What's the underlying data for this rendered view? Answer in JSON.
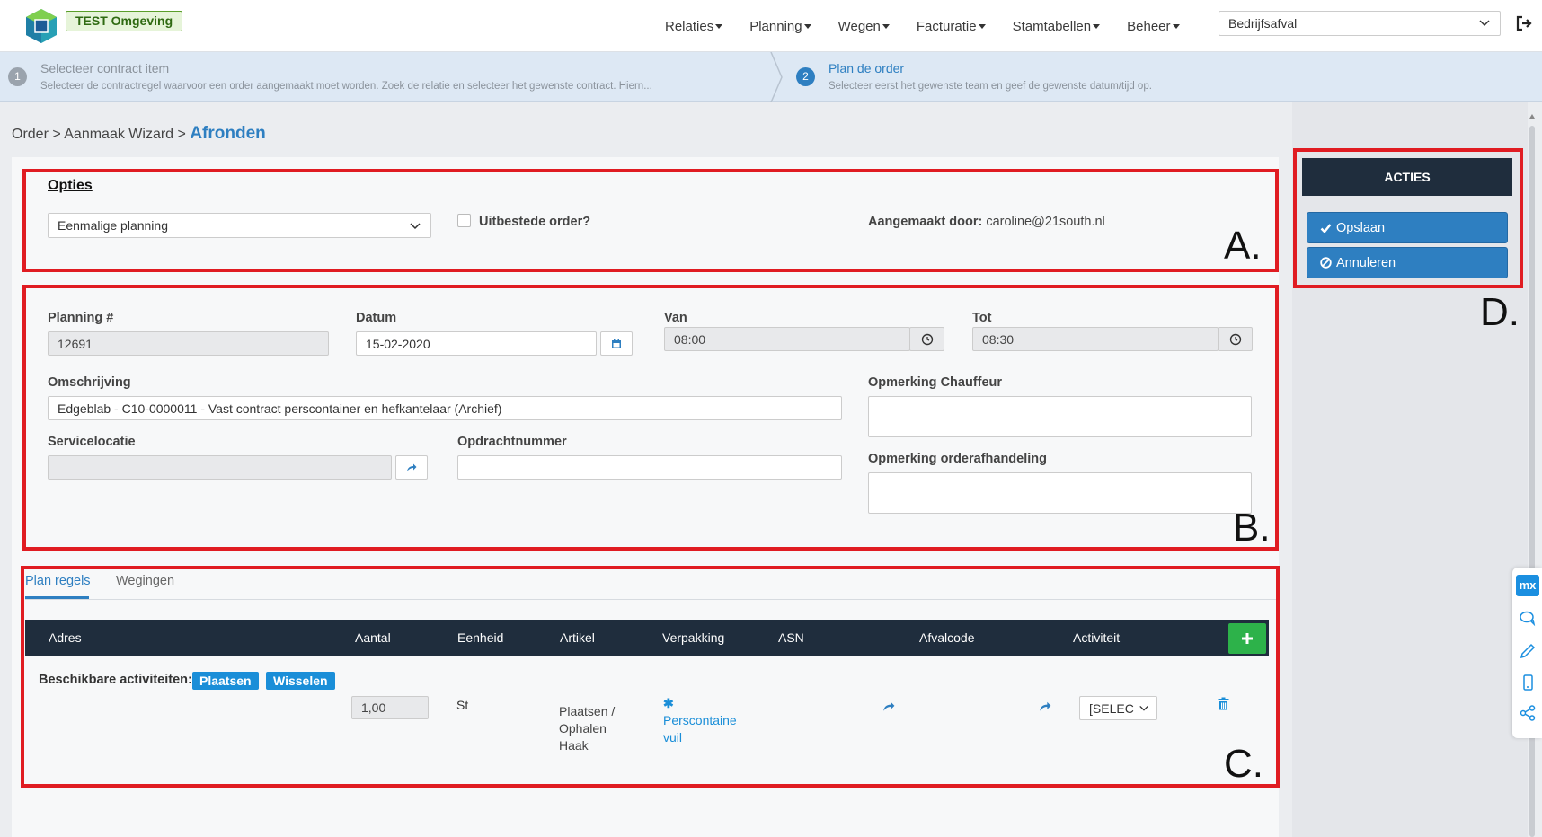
{
  "header": {
    "env_badge": "TEST Omgeving",
    "nav": [
      "Relaties",
      "Planning",
      "Wegen",
      "Facturatie",
      "Stamtabellen",
      "Beheer"
    ],
    "company": "Bedrijfsafval"
  },
  "steps": [
    {
      "number": "1",
      "title": "Selecteer contract item",
      "description": "Selecteer de contractregel waarvoor een order aangemaakt moet worden. Zoek de relatie en selecteer het gewenste contract. Hiern..."
    },
    {
      "number": "2",
      "title": "Plan de order",
      "description": "Selecteer eerst het gewenste team en geef de gewenste datum/tijd op."
    }
  ],
  "breadcrumb": {
    "prefix": "Order > Aanmaak Wizard > ",
    "current": "Afronden"
  },
  "options": {
    "title": "Opties",
    "planning_type": "Eenmalige planning",
    "outsourced_label": "Uitbestede order?",
    "created_by_label": "Aangemaakt door:",
    "created_by_value": "caroline@21south.nl",
    "marker": "A."
  },
  "form": {
    "planning_label": "Planning #",
    "planning_value": "12691",
    "date_label": "Datum",
    "date_value": "15-02-2020",
    "from_label": "Van",
    "from_value": "08:00",
    "to_label": "Tot",
    "to_value": "08:30",
    "description_label": "Omschrijving",
    "description_value": "Edgeblab - C10-0000011 - Vast contract perscontainer en hefkantelaar (Archief)",
    "driver_note_label": "Opmerking Chauffeur",
    "service_location_label": "Servicelocatie",
    "order_number_label": "Opdrachtnummer",
    "order_note_label": "Opmerking orderafhandeling",
    "marker": "B."
  },
  "tabs": [
    "Plan regels",
    "Wegingen"
  ],
  "table": {
    "headers": [
      "Adres",
      "Aantal",
      "Eenheid",
      "Artikel",
      "Verpakking",
      "ASN",
      "Afvalcode",
      "Activiteit"
    ],
    "available_label": "Beschikbare activiteiten:",
    "activities": [
      "Plaatsen",
      "Wisselen"
    ],
    "row": {
      "aantal": "1,00",
      "eenheid": "St",
      "artikel_1": "Plaatsen /",
      "artikel_2": "Ophalen",
      "artikel_3": "Haak",
      "verpakking_1": "Perscontaine",
      "verpakking_2": "vuil",
      "activiteit": "[SELEC"
    },
    "marker": "C."
  },
  "actions": {
    "header": "ACTIES",
    "save": "Opslaan",
    "cancel": "Annuleren",
    "marker": "D."
  },
  "dock": {
    "logo": "mx"
  },
  "colors": {
    "primary": "#2e7fc1",
    "dark": "#1f2d3d",
    "highlight": "#e01c22",
    "success": "#2db24a"
  }
}
